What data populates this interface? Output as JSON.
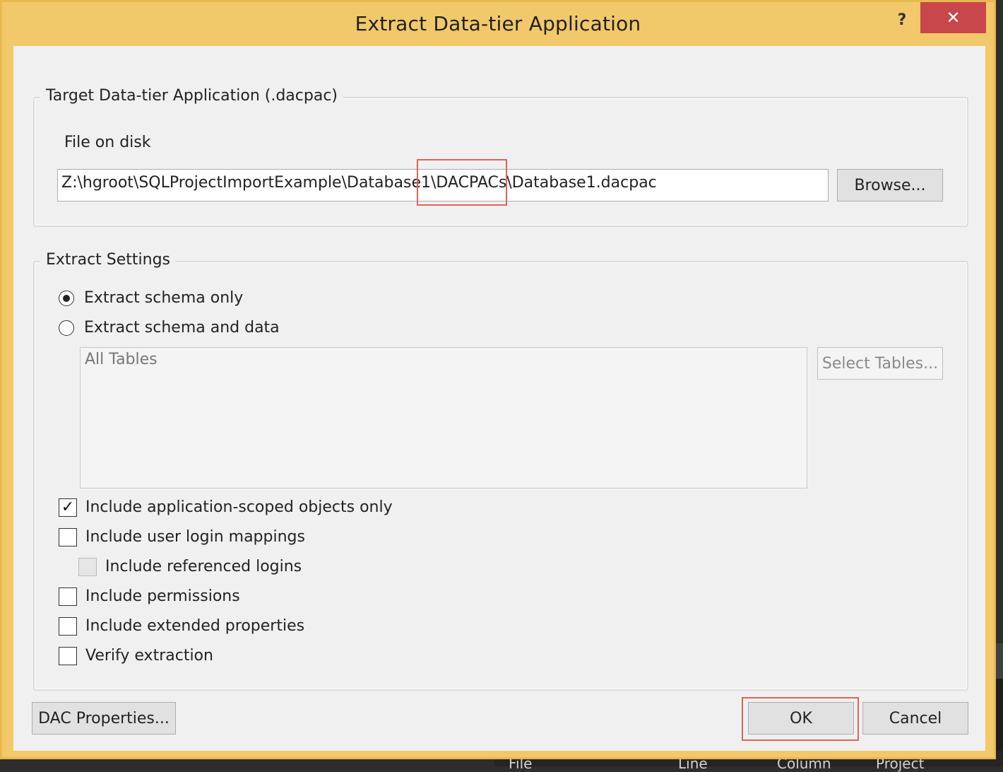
{
  "window": {
    "title": "Extract Data-tier Application",
    "help_label": "?",
    "close_label": "✕"
  },
  "target_group": {
    "legend": "Target Data-tier Application (.dacpac)",
    "file_label": "File on disk",
    "file_path": "Z:\\hgroot\\SQLProjectImportExample\\Database1\\DACPACs\\Database1.dacpac",
    "browse_label": "Browse..."
  },
  "settings_group": {
    "legend": "Extract Settings",
    "radio_schema_only": {
      "label": "Extract schema only",
      "checked": true
    },
    "radio_schema_data": {
      "label": "Extract schema and data",
      "checked": false
    },
    "tables_list_text": "All Tables",
    "select_tables_label": "Select Tables...",
    "checkboxes": [
      {
        "label": "Include application-scoped objects only",
        "checked": true,
        "enabled": true
      },
      {
        "label": "Include user login mappings",
        "checked": false,
        "enabled": true
      },
      {
        "label": "Include referenced logins",
        "checked": false,
        "enabled": false
      },
      {
        "label": "Include permissions",
        "checked": false,
        "enabled": true
      },
      {
        "label": "Include extended properties",
        "checked": false,
        "enabled": true
      },
      {
        "label": "Verify extraction",
        "checked": false,
        "enabled": true
      }
    ]
  },
  "buttons": {
    "dac_properties": "DAC Properties...",
    "ok": "OK",
    "cancel": "Cancel"
  },
  "background": {
    "col_file": "File",
    "col_line": "Line",
    "col_column": "Column",
    "col_project": "Project"
  },
  "colors": {
    "title_bar": "#f2c96a",
    "close_button": "#c7474a",
    "highlight": "#e0645a"
  }
}
